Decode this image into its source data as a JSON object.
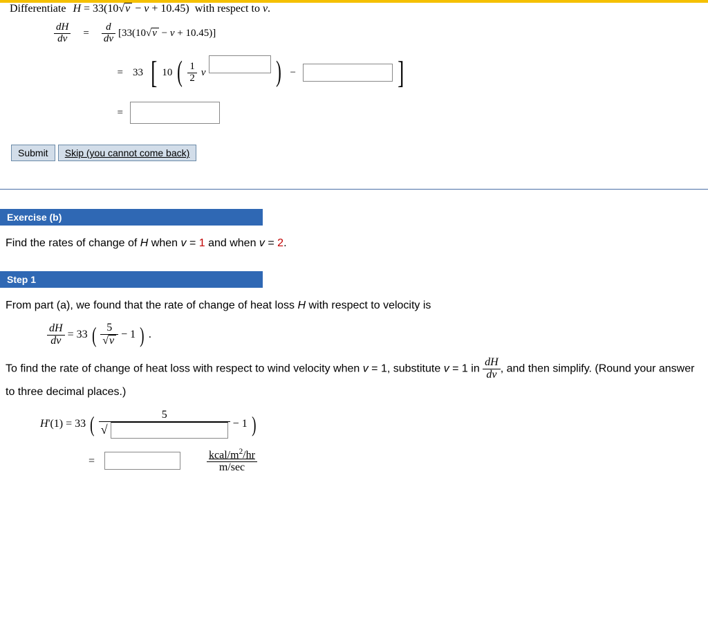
{
  "top": {
    "differentiate": "Differentiate",
    "differentiate_expr": " H = 33(10√v − v + 10.45)  with respect to v.",
    "lhs_num": "dH",
    "lhs_den": "dv",
    "rhs1_op_num": "d",
    "rhs1_op_den": "dv",
    "rhs1_body": "[33(10√v − v + 10.45)]",
    "eq": "=",
    "coef_33": "33",
    "ten": "10",
    "half_num": "1",
    "half_den": "2",
    "var_v": "v",
    "minus": "−"
  },
  "buttons": {
    "submit": "Submit",
    "skip": "Skip (you cannot come back)"
  },
  "exerciseB": {
    "header": "Exercise (b)",
    "prose_1": "Find the rates of change of ",
    "H": "H",
    "prose_2": " when ",
    "v": "v",
    "eq1": " = ",
    "one": "1",
    "and": " and when ",
    "two": "2",
    "period": "."
  },
  "step1": {
    "header": "Step 1",
    "p1_a": "From part (a), we found that the rate of change of heat loss ",
    "p1_b": " with respect to velocity is",
    "derivEq": {
      "num": "dH",
      "den": "dv",
      "eq": " = 33",
      "five": "5",
      "sqrt_v": "v",
      "minus1": " − 1",
      "dot": "."
    },
    "p2_a": "To find the rate of change of heat loss with respect to wind velocity when ",
    "p2_b": " = 1, substitute ",
    "p2_c": " = 1 in ",
    "p2_d": ", and then simplify. (Round your answer to three decimal places.)",
    "Hprime": "H'(1) = 33",
    "five": "5",
    "minus1": " − 1",
    "eq": "=",
    "units_num": "kcal/m²/hr",
    "units_den": "m/sec"
  }
}
